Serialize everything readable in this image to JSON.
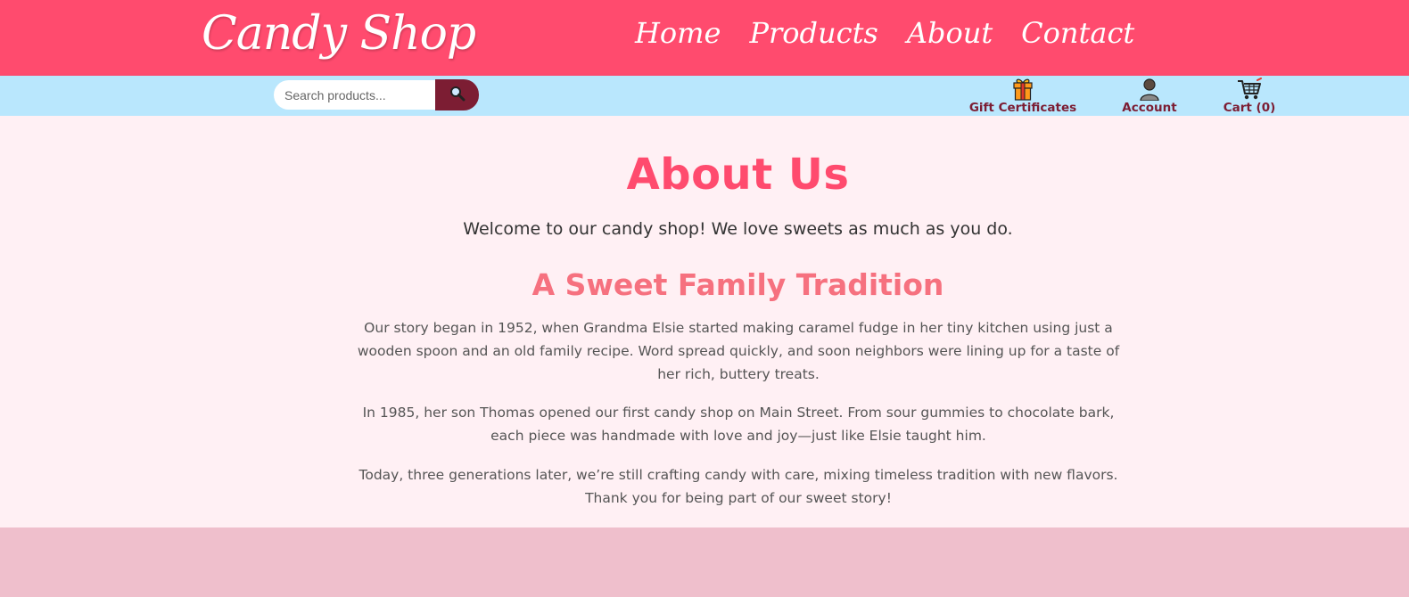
{
  "brand": {
    "logo": "Candy Shop"
  },
  "nav": {
    "items": [
      {
        "label": "Home"
      },
      {
        "label": "Products"
      },
      {
        "label": "About"
      },
      {
        "label": "Contact"
      }
    ]
  },
  "search": {
    "placeholder": "Search products...",
    "button_icon": "search-icon"
  },
  "utility": {
    "gift": {
      "label": "Gift Certificates",
      "icon": "gift-icon"
    },
    "account": {
      "label": "Account",
      "icon": "user-icon"
    },
    "cart": {
      "label": "Cart (0)",
      "icon": "cart-icon"
    }
  },
  "page": {
    "title": "About Us",
    "welcome": "Welcome to our candy shop! We love sweets as much as you do.",
    "subtitle": "A Sweet Family Tradition",
    "paragraphs": [
      "Our story began in 1952, when Grandma Elsie started making caramel fudge in her tiny kitchen using just a wooden spoon and an old family recipe. Word spread quickly, and soon neighbors were lining up for a taste of her rich, buttery treats.",
      "In 1985, her son Thomas opened our first candy shop on Main Street. From sour gummies to chocolate bark, each piece was handmade with love and joy—just like Elsie taught him.",
      "Today, three generations later, we’re still crafting candy with care, mixing timeless tradition with new flavors. Thank you for being part of our sweet story!"
    ]
  },
  "colors": {
    "header": "#ff4b6e",
    "subbar": "#b9e7fd",
    "accent_dark": "#7c1d33",
    "content_bg": "#fff0f4",
    "footer": "#efbfcc",
    "subtitle": "#f6717f"
  }
}
